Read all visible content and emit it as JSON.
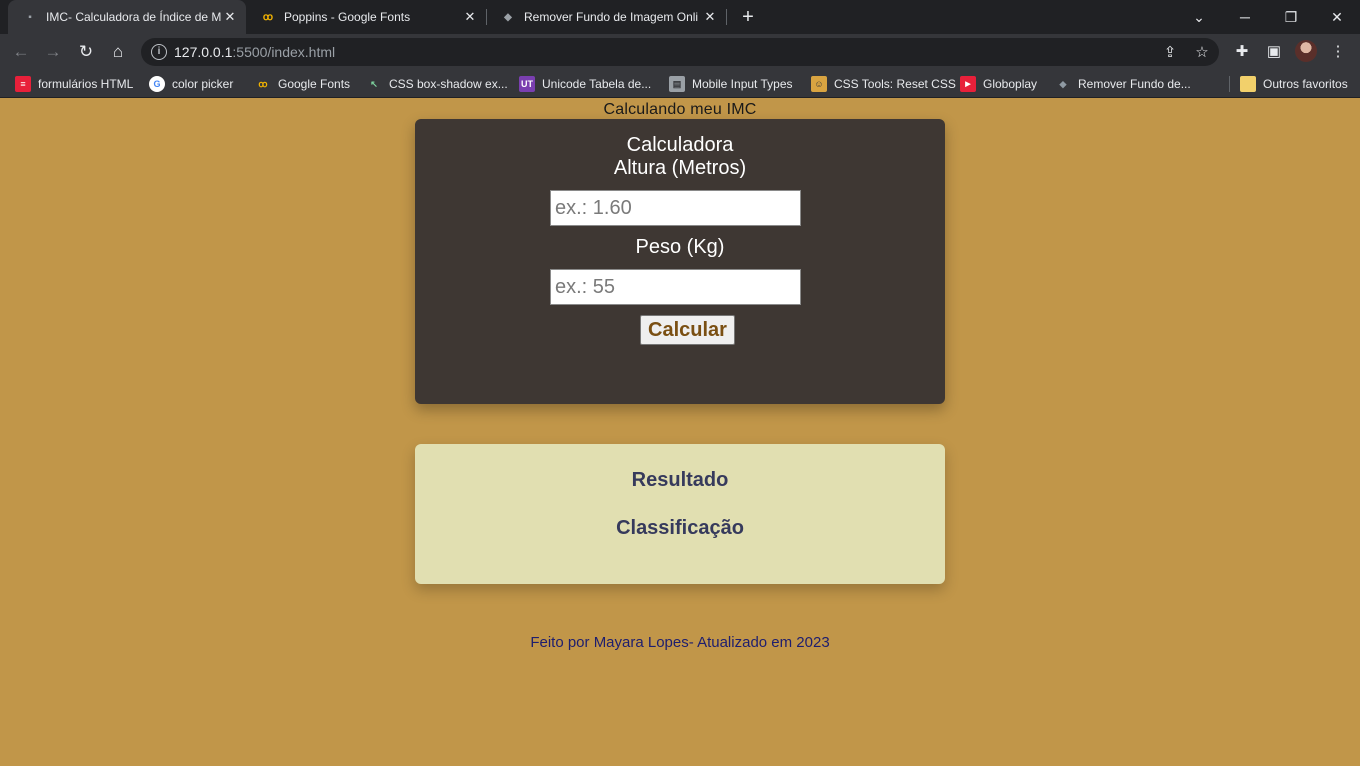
{
  "browser": {
    "tabs": [
      {
        "title": "IMC- Calculadora de Índice de M",
        "icon": "document-icon",
        "active": true
      },
      {
        "title": "Poppins - Google Fonts",
        "icon": "google-fonts-icon",
        "active": false
      },
      {
        "title": "Remover Fundo de Imagem Onli",
        "icon": "layers-icon",
        "active": false
      }
    ],
    "url_host": "127.0.0.1",
    "url_rest": ":5500/index.html",
    "bookmarks": [
      {
        "label": "formulários HTML",
        "color": "#e8203a"
      },
      {
        "label": "color picker",
        "color": "#ffffff"
      },
      {
        "label": "Google Fonts",
        "color": "#f4b400"
      },
      {
        "label": "CSS box-shadow ex...",
        "color": "#2d5a3a"
      },
      {
        "label": "Unicode Tabela de...",
        "color": "#7a3fb0"
      },
      {
        "label": "Mobile Input Types",
        "color": "#9aa0a6"
      },
      {
        "label": "CSS Tools: Reset CSS",
        "color": "#d9a441"
      },
      {
        "label": "Globoplay",
        "color": "#e8203a"
      },
      {
        "label": "Remover Fundo de...",
        "color": "#8f9aa3"
      }
    ],
    "other_bookmarks": "Outros favoritos"
  },
  "page": {
    "heading": "Calculando meu IMC",
    "calculator": {
      "title": "Calculadora",
      "height_label": "Altura (Metros)",
      "height_placeholder": "ex.: 1.60",
      "weight_label": "Peso (Kg)",
      "weight_placeholder": "ex.: 55",
      "button_label": "Calcular"
    },
    "result": {
      "result_label": "Resultado",
      "classification_label": "Classificação"
    },
    "footer": "Feito por Mayara Lopes- Atualizado em 2023"
  },
  "colors": {
    "page_background": "#c19649",
    "calculator_card": "#3e3733",
    "result_card": "#e1dfb1",
    "button_text": "#7a4f12",
    "result_text": "#363a5c",
    "footer_text": "#1e1e6e"
  }
}
